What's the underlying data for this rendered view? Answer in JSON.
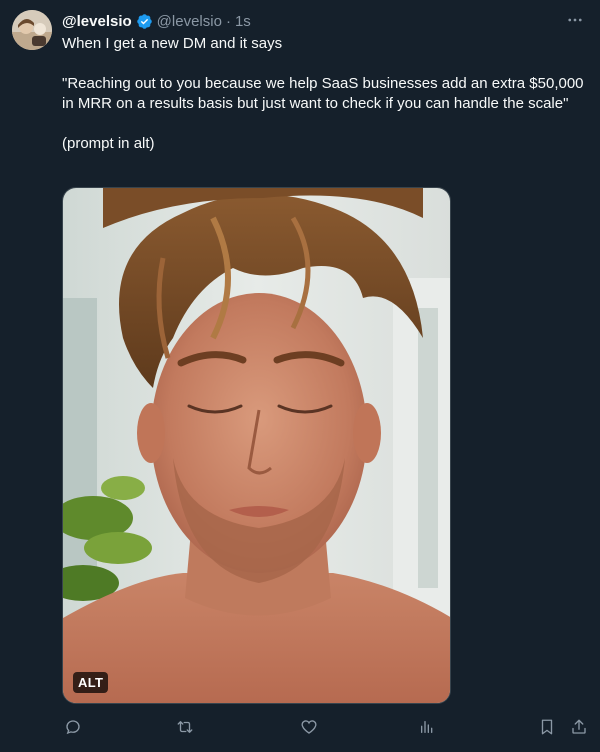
{
  "tweet": {
    "display_name": "@levelsio",
    "handle": "@levelsio",
    "separator": "·",
    "time": "1s",
    "lines": [
      "When I get a new DM and it says",
      "\"Reaching out to you because we help SaaS businesses add an extra $50,000 in MRR on a results basis but just want to check if you can handle the scale\"",
      "(prompt in alt)"
    ],
    "media": {
      "alt_badge": "ALT",
      "subject": "photo-man-with-closed-eyes"
    }
  },
  "actions": {
    "icons": [
      "reply-icon",
      "retweet-icon",
      "like-icon",
      "views-icon",
      "bookmark-icon",
      "share-icon"
    ]
  },
  "colors": {
    "background": "#15202b",
    "text": "#f7f9f9",
    "muted": "#8b98a5",
    "verified": "#1d9bf0"
  }
}
